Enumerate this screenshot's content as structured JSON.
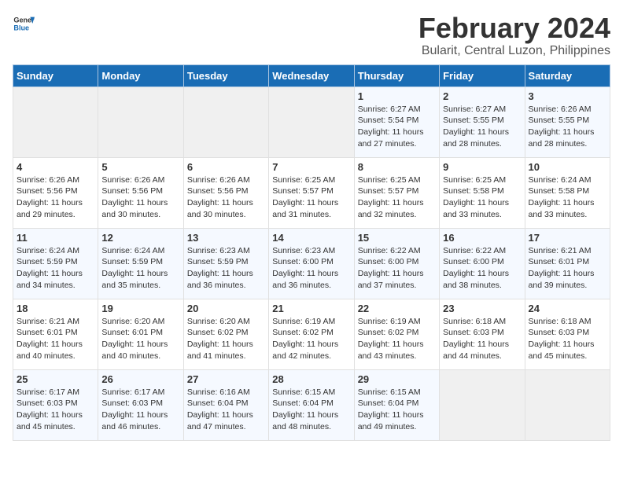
{
  "header": {
    "logo_line1": "General",
    "logo_line2": "Blue",
    "title": "February 2024",
    "subtitle": "Bularit, Central Luzon, Philippines"
  },
  "columns": [
    "Sunday",
    "Monday",
    "Tuesday",
    "Wednesday",
    "Thursday",
    "Friday",
    "Saturday"
  ],
  "weeks": [
    [
      {
        "day": "",
        "info": ""
      },
      {
        "day": "",
        "info": ""
      },
      {
        "day": "",
        "info": ""
      },
      {
        "day": "",
        "info": ""
      },
      {
        "day": "1",
        "info": "Sunrise: 6:27 AM\nSunset: 5:54 PM\nDaylight: 11 hours and 27 minutes."
      },
      {
        "day": "2",
        "info": "Sunrise: 6:27 AM\nSunset: 5:55 PM\nDaylight: 11 hours and 28 minutes."
      },
      {
        "day": "3",
        "info": "Sunrise: 6:26 AM\nSunset: 5:55 PM\nDaylight: 11 hours and 28 minutes."
      }
    ],
    [
      {
        "day": "4",
        "info": "Sunrise: 6:26 AM\nSunset: 5:56 PM\nDaylight: 11 hours and 29 minutes."
      },
      {
        "day": "5",
        "info": "Sunrise: 6:26 AM\nSunset: 5:56 PM\nDaylight: 11 hours and 30 minutes."
      },
      {
        "day": "6",
        "info": "Sunrise: 6:26 AM\nSunset: 5:56 PM\nDaylight: 11 hours and 30 minutes."
      },
      {
        "day": "7",
        "info": "Sunrise: 6:25 AM\nSunset: 5:57 PM\nDaylight: 11 hours and 31 minutes."
      },
      {
        "day": "8",
        "info": "Sunrise: 6:25 AM\nSunset: 5:57 PM\nDaylight: 11 hours and 32 minutes."
      },
      {
        "day": "9",
        "info": "Sunrise: 6:25 AM\nSunset: 5:58 PM\nDaylight: 11 hours and 33 minutes."
      },
      {
        "day": "10",
        "info": "Sunrise: 6:24 AM\nSunset: 5:58 PM\nDaylight: 11 hours and 33 minutes."
      }
    ],
    [
      {
        "day": "11",
        "info": "Sunrise: 6:24 AM\nSunset: 5:59 PM\nDaylight: 11 hours and 34 minutes."
      },
      {
        "day": "12",
        "info": "Sunrise: 6:24 AM\nSunset: 5:59 PM\nDaylight: 11 hours and 35 minutes."
      },
      {
        "day": "13",
        "info": "Sunrise: 6:23 AM\nSunset: 5:59 PM\nDaylight: 11 hours and 36 minutes."
      },
      {
        "day": "14",
        "info": "Sunrise: 6:23 AM\nSunset: 6:00 PM\nDaylight: 11 hours and 36 minutes."
      },
      {
        "day": "15",
        "info": "Sunrise: 6:22 AM\nSunset: 6:00 PM\nDaylight: 11 hours and 37 minutes."
      },
      {
        "day": "16",
        "info": "Sunrise: 6:22 AM\nSunset: 6:00 PM\nDaylight: 11 hours and 38 minutes."
      },
      {
        "day": "17",
        "info": "Sunrise: 6:21 AM\nSunset: 6:01 PM\nDaylight: 11 hours and 39 minutes."
      }
    ],
    [
      {
        "day": "18",
        "info": "Sunrise: 6:21 AM\nSunset: 6:01 PM\nDaylight: 11 hours and 40 minutes."
      },
      {
        "day": "19",
        "info": "Sunrise: 6:20 AM\nSunset: 6:01 PM\nDaylight: 11 hours and 40 minutes."
      },
      {
        "day": "20",
        "info": "Sunrise: 6:20 AM\nSunset: 6:02 PM\nDaylight: 11 hours and 41 minutes."
      },
      {
        "day": "21",
        "info": "Sunrise: 6:19 AM\nSunset: 6:02 PM\nDaylight: 11 hours and 42 minutes."
      },
      {
        "day": "22",
        "info": "Sunrise: 6:19 AM\nSunset: 6:02 PM\nDaylight: 11 hours and 43 minutes."
      },
      {
        "day": "23",
        "info": "Sunrise: 6:18 AM\nSunset: 6:03 PM\nDaylight: 11 hours and 44 minutes."
      },
      {
        "day": "24",
        "info": "Sunrise: 6:18 AM\nSunset: 6:03 PM\nDaylight: 11 hours and 45 minutes."
      }
    ],
    [
      {
        "day": "25",
        "info": "Sunrise: 6:17 AM\nSunset: 6:03 PM\nDaylight: 11 hours and 45 minutes."
      },
      {
        "day": "26",
        "info": "Sunrise: 6:17 AM\nSunset: 6:03 PM\nDaylight: 11 hours and 46 minutes."
      },
      {
        "day": "27",
        "info": "Sunrise: 6:16 AM\nSunset: 6:04 PM\nDaylight: 11 hours and 47 minutes."
      },
      {
        "day": "28",
        "info": "Sunrise: 6:15 AM\nSunset: 6:04 PM\nDaylight: 11 hours and 48 minutes."
      },
      {
        "day": "29",
        "info": "Sunrise: 6:15 AM\nSunset: 6:04 PM\nDaylight: 11 hours and 49 minutes."
      },
      {
        "day": "",
        "info": ""
      },
      {
        "day": "",
        "info": ""
      }
    ]
  ]
}
